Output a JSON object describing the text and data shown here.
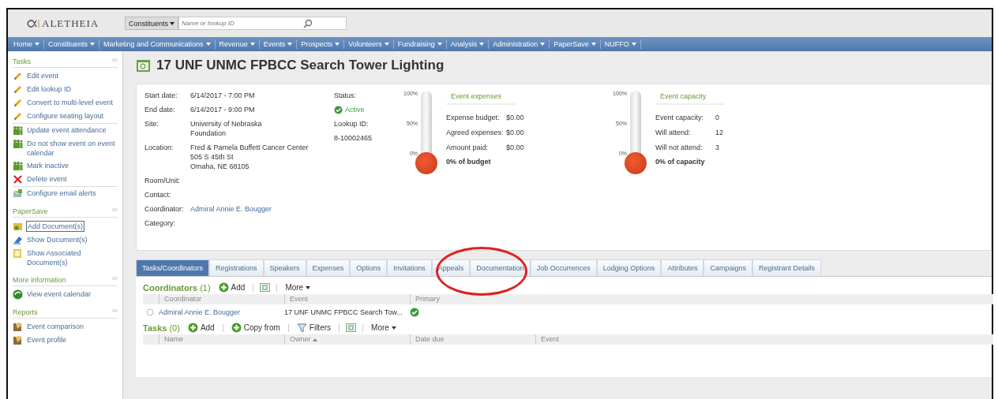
{
  "header": {
    "logo": "ALETHEIA",
    "search_scope": "Constituents",
    "search": {
      "placeholder": "Name or lookup ID"
    }
  },
  "nav": [
    "Home",
    "Constituents",
    "Marketing and Communications",
    "Revenue",
    "Events",
    "Prospects",
    "Volunteers",
    "Fundraising",
    "Analysis",
    "Administration",
    "PaperSave",
    "NUFFO"
  ],
  "sidebar": [
    {
      "title": "Tasks",
      "items": [
        {
          "label": "Edit event",
          "kind": "pencil"
        },
        {
          "label": "Edit lookup ID",
          "kind": "pencil"
        },
        {
          "label": "Convert to multi-level event",
          "kind": "pencil"
        },
        {
          "label": "Configure seating layout",
          "kind": "pencil"
        },
        {
          "label": "Update event attendance",
          "kind": "people"
        },
        {
          "label": "Do not show event on event calendar",
          "kind": "people"
        },
        {
          "label": "Mark inactive",
          "kind": "people"
        },
        {
          "label": "Delete event",
          "kind": "cross"
        },
        {
          "label": "Configure email alerts",
          "kind": "mail"
        }
      ]
    },
    {
      "title": "PaperSave",
      "items": [
        {
          "label": "Add Document(s)",
          "kind": "folder",
          "selected": true
        },
        {
          "label": "Show Document(s)",
          "kind": "document",
          "selected": false
        },
        {
          "label": "Show Associated Document(s)",
          "kind": "bundle",
          "selected": false
        }
      ]
    },
    {
      "title": "More information",
      "items": [
        {
          "label": "View event calendar",
          "kind": "calendar"
        }
      ]
    },
    {
      "title": "Reports",
      "items": [
        {
          "label": "Event comparison",
          "kind": "report"
        },
        {
          "label": "Event profile",
          "kind": "report"
        }
      ]
    }
  ],
  "page_title": "17 UNF UNMC FPBCC Search Tower Lighting",
  "details": [
    {
      "label": "Start date:",
      "lines": [
        "6/14/2017 - 7:00 PM"
      ]
    },
    {
      "label": "End date:",
      "lines": [
        "6/14/2017 - 9:00 PM"
      ]
    },
    {
      "label": "Site:",
      "lines": [
        "University of Nebraska",
        "Foundation"
      ]
    },
    {
      "label": "Location:",
      "lines": [
        "Fred & Pamela Buffett Cancer Center",
        "505 S 45th St",
        "Omaha, NE  68105"
      ]
    },
    {
      "label": "Room/Unit:"
    },
    {
      "label": "Contact:"
    },
    {
      "label": "Coordinator:",
      "lines": [
        "Admiral Annie E. Bougger"
      ],
      "kind": "link"
    },
    {
      "label": "Category:"
    }
  ],
  "status": {
    "label": "Status:",
    "value": "Active",
    "lookup_label": "Lookup ID:",
    "lookup_id": "8-10002465"
  },
  "gauges": [
    {
      "ticks": [
        "100%",
        "50%",
        "0%"
      ],
      "level": 0,
      "title": "Event expenses",
      "rows": [
        {
          "label": "Expense budget:",
          "value": "$0.00"
        },
        {
          "label": "Agreed expenses:",
          "value": "$0.00"
        },
        {
          "label": "Amount paid:",
          "value": "$0.00"
        }
      ],
      "summary": "0% of budget"
    },
    {
      "ticks": [
        "100%",
        "50%",
        "0%"
      ],
      "level": 0,
      "title": "Event capacity",
      "rows": [
        {
          "label": "Event capacity:",
          "value": "0"
        },
        {
          "label": "Will attend:",
          "value": "12"
        },
        {
          "label": "Will not attend:",
          "value": "3"
        }
      ],
      "summary": "0% of capacity"
    }
  ],
  "tabs": [
    {
      "label": "Tasks/Coordinators",
      "selected": true
    },
    {
      "label": "Registrations",
      "selected": false
    },
    {
      "label": "Speakers",
      "selected": false
    },
    {
      "label": "Expenses",
      "selected": false
    },
    {
      "label": "Options",
      "selected": false
    },
    {
      "label": "Invitations",
      "selected": false
    },
    {
      "label": "Appeals",
      "selected": false
    },
    {
      "label": "Documentation",
      "selected": false
    },
    {
      "label": "Job Occurrences",
      "selected": false
    },
    {
      "label": "Lodging Options",
      "selected": false
    },
    {
      "label": "Attributes",
      "selected": false
    },
    {
      "label": "Campaigns",
      "selected": false
    },
    {
      "label": "Registrant Details",
      "selected": false
    }
  ],
  "sections": [
    {
      "title": "Coordinators",
      "count": "(1)",
      "actions": [
        {
          "kind": "add",
          "label": "Add"
        },
        {
          "kind": "refresh"
        },
        {
          "kind": "more",
          "label": "More"
        }
      ],
      "columns": [
        {
          "label": "Coordinator"
        },
        {
          "label": "Event"
        },
        {
          "label": "Primary"
        }
      ],
      "rows": [
        {
          "coordinator": "Admiral Annie E. Bougger",
          "event": "17 UNF UNMC FPBCC Search Tow...",
          "primary": true
        }
      ]
    },
    {
      "title": "Tasks",
      "count": "(0)",
      "actions": [
        {
          "kind": "add",
          "label": "Add"
        },
        {
          "kind": "add",
          "label": "Copy from"
        },
        {
          "kind": "filter",
          "label": "Filters"
        },
        {
          "kind": "refresh"
        },
        {
          "kind": "more",
          "label": "More"
        }
      ],
      "columns": [
        {
          "label": "Name"
        },
        {
          "label": "Owner",
          "sorted": true
        },
        {
          "label": "Date due"
        },
        {
          "label": "Event"
        }
      ]
    }
  ],
  "annotation": {
    "kind": "ellipse"
  }
}
